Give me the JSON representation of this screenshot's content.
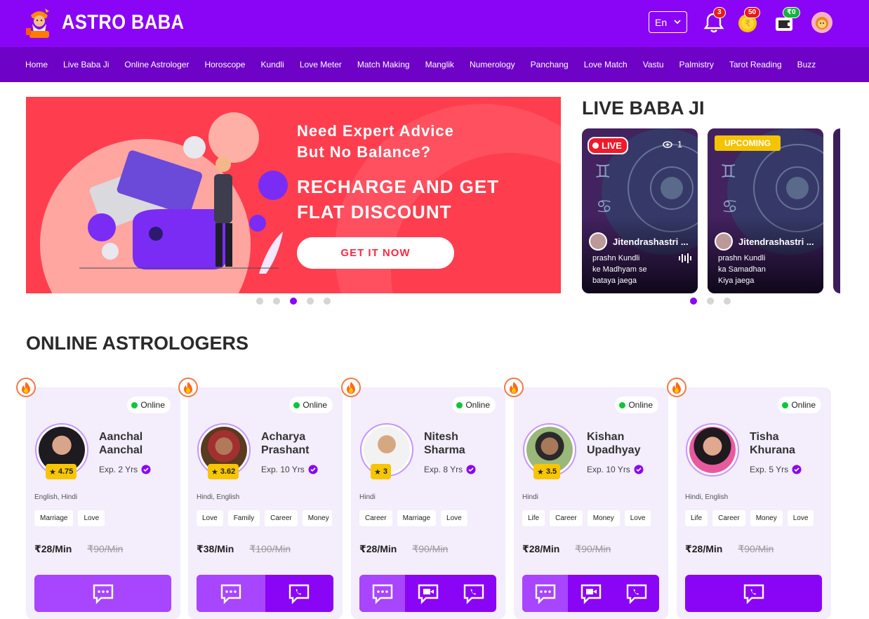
{
  "header": {
    "brand": "ASTRO BABA",
    "language": "En",
    "notifications_count": "3",
    "coins_count": "50",
    "wallet_balance": "₹0"
  },
  "nav": [
    "Home",
    "Live Baba Ji",
    "Online Astrologer",
    "Horoscope",
    "Kundli",
    "Love Meter",
    "Match Making",
    "Manglik",
    "Numerology",
    "Panchang",
    "Love Match",
    "Vastu",
    "Palmistry",
    "Tarot Reading",
    "Buzz"
  ],
  "banner": {
    "line1": "Need Expert Advice",
    "line2": "But No Balance?",
    "headline1": "RECHARGE AND GET",
    "headline2": "FLAT DISCOUNT",
    "cta": "GET IT NOW",
    "slide_count": 5,
    "active_slide": 3
  },
  "live": {
    "title": "LIVE BABA JI",
    "cards": [
      {
        "badge": "LIVE",
        "viewers": "1",
        "name": "Jitendrashastri ...",
        "desc1": "prashn Kundli",
        "desc2": "ke Madhyam se",
        "desc3": "bataya jaega"
      },
      {
        "badge": "UPCOMING",
        "name": "Jitendrashastri ...",
        "desc1": "prashn Kundli",
        "desc2": "ka Samadhan",
        "desc3": "Kiya jaega"
      }
    ],
    "slide_count": 3,
    "active_slide": 1
  },
  "online": {
    "title": "ONLINE ASTROLOGERS",
    "status_label": "Online",
    "astrologers": [
      {
        "name1": "Aanchal",
        "name2": "Aanchal",
        "rating": "4.75",
        "exp": "Exp. 2 Yrs",
        "languages": "English, Hindi",
        "tags": [
          "Marriage",
          "Love"
        ],
        "price": "₹28/Min",
        "old_price": "₹90/Min",
        "actions": [
          "chat"
        ]
      },
      {
        "name1": "Acharya",
        "name2": "Prashant",
        "rating": "3.62",
        "exp": "Exp. 10 Yrs",
        "languages": "Hindi, English",
        "tags": [
          "Love",
          "Family",
          "Career",
          "Money"
        ],
        "price": "₹38/Min",
        "old_price": "₹100/Min",
        "actions": [
          "chat",
          "call"
        ]
      },
      {
        "name1": "Nitesh",
        "name2": "Sharma",
        "rating": "3",
        "exp": "Exp. 8 Yrs",
        "languages": "Hindi",
        "tags": [
          "Career",
          "Marriage",
          "Love"
        ],
        "price": "₹28/Min",
        "old_price": "₹90/Min",
        "actions": [
          "chat",
          "video",
          "call"
        ]
      },
      {
        "name1": "Kishan",
        "name2": "Upadhyay",
        "rating": "3.5",
        "exp": "Exp. 10 Yrs",
        "languages": "Hindi",
        "tags": [
          "Life",
          "Career",
          "Money",
          "Love"
        ],
        "price": "₹28/Min",
        "old_price": "₹90/Min",
        "actions": [
          "chat",
          "video",
          "call"
        ]
      },
      {
        "name1": "Tisha",
        "name2": "Khurana",
        "rating": "",
        "exp": "Exp. 5 Yrs",
        "languages": "Hindi, English",
        "tags": [
          "Life",
          "Career",
          "Money",
          "Love"
        ],
        "price": "₹28/Min",
        "old_price": "₹90/Min",
        "actions": [
          "call"
        ]
      }
    ]
  },
  "colors": {
    "primary": "#8a05f6",
    "nav": "#6e02c6",
    "banner": "#fe3e4e",
    "rating": "#f7c600",
    "online": "#10c43a"
  }
}
